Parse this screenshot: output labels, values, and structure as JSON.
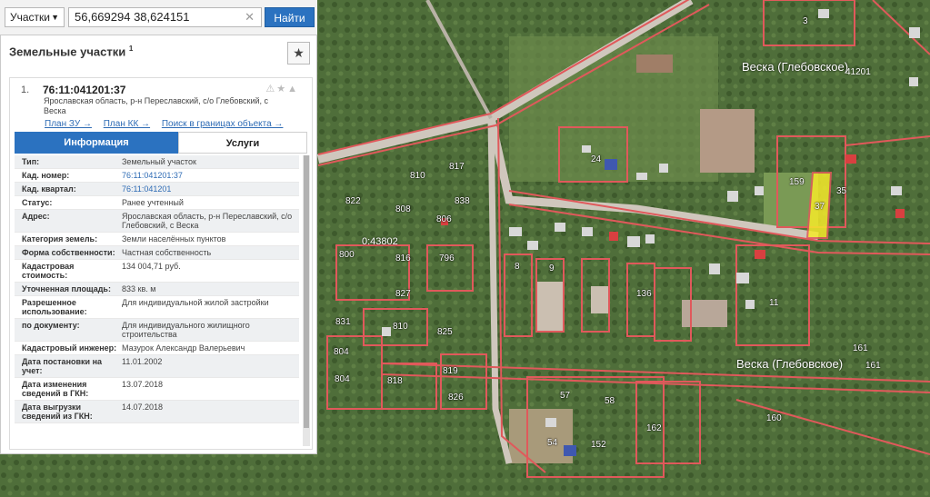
{
  "search": {
    "type_label": "Участки",
    "query": "56,669294 38,624151",
    "button": "Найти"
  },
  "panel": {
    "title": "Земельные участки",
    "title_count": "1",
    "star_glyph": "★",
    "item": {
      "index": "1.",
      "cad_number": "76:11:041201:37",
      "address": "Ярославская область, р-н Переславский, с/о Глебовский, с Веска",
      "links": [
        "План ЗУ →",
        "План КК →",
        "Поиск в границах объекта →"
      ]
    },
    "tabs": [
      "Информация",
      "Услуги"
    ],
    "rows": [
      {
        "key": "Тип:",
        "value": "Земельный участок"
      },
      {
        "key": "Кад. номер:",
        "value": "76:11:041201:37"
      },
      {
        "key": "Кад. квартал:",
        "value": "76:11:041201"
      },
      {
        "key": "Статус:",
        "value": "Ранее учтенный"
      },
      {
        "key": "Адрес:",
        "value": "Ярославская область, р-н Переславский, с/о Глебовский, с Веска"
      },
      {
        "key": "Категория земель:",
        "value": "Земли населённых пунктов"
      },
      {
        "key": "Форма собственности:",
        "value": "Частная собственность"
      },
      {
        "key": "Кадастровая стоимость:",
        "value": "134 004,71 руб."
      },
      {
        "key": "Уточненная площадь:",
        "value": "833 кв. м"
      },
      {
        "key": "Разрешенное использование:",
        "value": "Для индивидуальной жилой застройки"
      },
      {
        "key": "по документу:",
        "value": "Для индивидуального жилищного строительства"
      },
      {
        "key": "Кадастровый инженер:",
        "value": "Мазурок Александр Валерьевич"
      },
      {
        "key": "Дата постановки на учет:",
        "value": "11.01.2002"
      },
      {
        "key": "Дата изменения сведений в ГКН:",
        "value": "13.07.2018"
      },
      {
        "key": "Дата выгрузки сведений из ГКН:",
        "value": "14.07.2018"
      }
    ]
  },
  "map": {
    "village_labels": [
      "Веска (Глебовское)",
      "Веска (Глебовское)"
    ],
    "block_label": "0:43802",
    "quarter_tag": "41201",
    "parcels": [
      "3",
      "24",
      "817",
      "810",
      "822",
      "838",
      "808",
      "806",
      "800",
      "816",
      "796",
      "8",
      "9",
      "827",
      "831",
      "810",
      "825",
      "804",
      "818",
      "819",
      "804",
      "826",
      "57",
      "58",
      "54",
      "152",
      "162",
      "160",
      "161",
      "161",
      "11",
      "159",
      "37",
      "35",
      "136"
    ],
    "colors": {
      "road": "#cfc7bd",
      "boundary": "#e0595b",
      "selected": "#f5ea2a"
    }
  }
}
